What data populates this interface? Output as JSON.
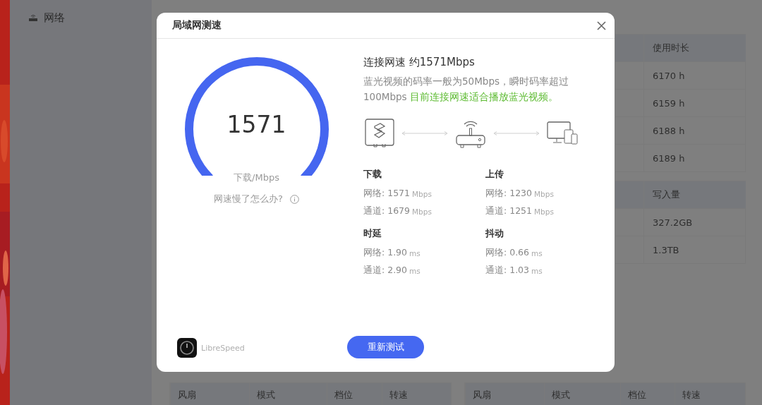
{
  "sidebar": {
    "items": [
      {
        "label": "网络"
      }
    ]
  },
  "right_tables": [
    {
      "columns": [
        "使用时长"
      ],
      "rows": [
        "6170 h",
        "6159 h",
        "6188 h",
        "6189 h"
      ]
    },
    {
      "columns": [
        "写入量"
      ],
      "rows": [
        "327.2GB",
        "1.3TB"
      ]
    }
  ],
  "bottom_tables": [
    {
      "columns": [
        "风扇",
        "模式",
        "档位",
        "转速"
      ]
    },
    {
      "columns": [
        "风扇",
        "模式",
        "档位",
        "转速"
      ]
    }
  ],
  "dialog": {
    "title": "局域网测速",
    "gauge": {
      "value": "1571",
      "unit_label": "下载/Mbps"
    },
    "help_link": "网速慢了怎么办?",
    "connection_title": "连接网速 约1571Mbps",
    "description": "蓝光视频的码率一般为50Mbps，瞬时码率超过100Mbps ",
    "description_highlight": "目前连接网速适合播放蓝光视频。",
    "stats": [
      {
        "heading": "下载",
        "rows": [
          {
            "label": "网络: 1571",
            "unit": "Mbps"
          },
          {
            "label": "通道: 1679",
            "unit": "Mbps"
          }
        ]
      },
      {
        "heading": "上传",
        "rows": [
          {
            "label": "网络: 1230",
            "unit": "Mbps"
          },
          {
            "label": "通道: 1251",
            "unit": "Mbps"
          }
        ]
      },
      {
        "heading": "时延",
        "rows": [
          {
            "label": "网络: 1.90",
            "unit": "ms"
          },
          {
            "label": "通道: 2.90",
            "unit": "ms"
          }
        ]
      },
      {
        "heading": "抖动",
        "rows": [
          {
            "label": "网络: 0.66",
            "unit": "ms"
          },
          {
            "label": "通道: 1.03",
            "unit": "ms"
          }
        ]
      }
    ],
    "brand": "LibreSpeed",
    "retest_button": "重新测试"
  }
}
